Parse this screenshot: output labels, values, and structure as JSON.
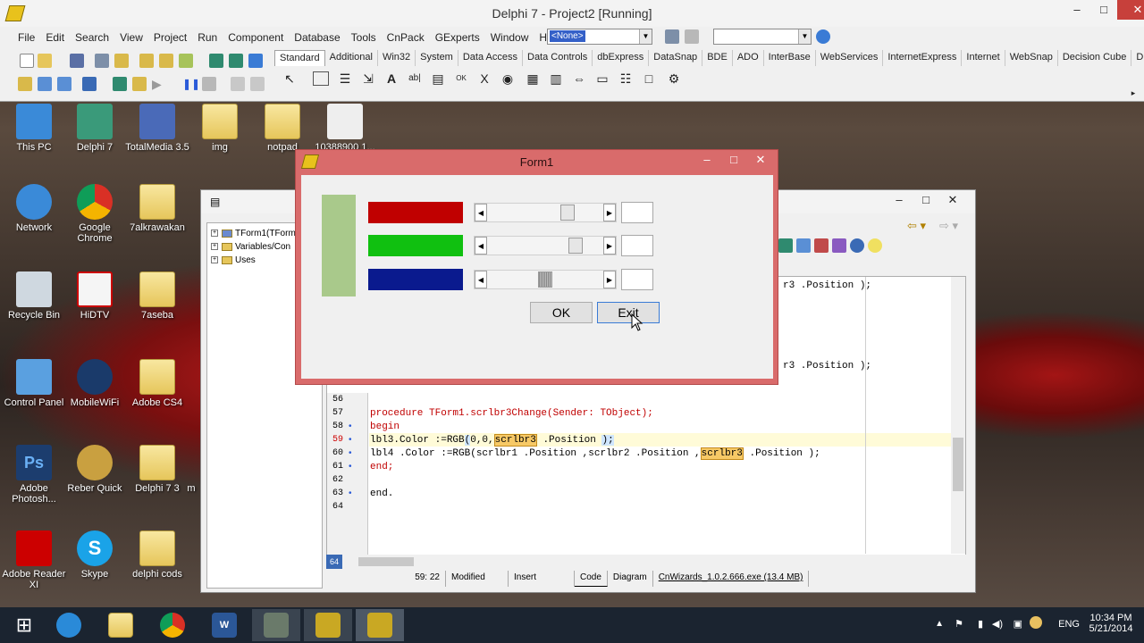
{
  "ide": {
    "title": "Delphi 7 - Project2 [Running]",
    "menu": [
      "File",
      "Edit",
      "Search",
      "View",
      "Project",
      "Run",
      "Component",
      "Database",
      "Tools",
      "CnPack",
      "GExperts",
      "Window",
      "Help"
    ],
    "desktop_combo": "<None>",
    "palette_tabs": [
      "Standard",
      "Additional",
      "Win32",
      "System",
      "Data Access",
      "Data Controls",
      "dbExpress",
      "DataSnap",
      "BDE",
      "ADO",
      "InterBase",
      "WebServices",
      "InternetExpress",
      "Internet",
      "WebSnap",
      "Decision Cube",
      "Dialo"
    ],
    "palette_labels": [
      "A",
      "ab|",
      "OK",
      "X"
    ]
  },
  "desktop": {
    "icons": [
      {
        "label": "This PC"
      },
      {
        "label": "Delphi 7"
      },
      {
        "label": "TotalMedia 3.5"
      },
      {
        "label": "img"
      },
      {
        "label": "notpad"
      },
      {
        "label": "10388900 1..."
      },
      {
        "label": "Network"
      },
      {
        "label": "Google Chrome"
      },
      {
        "label": "7alkrawakan"
      },
      {
        "label": "Recycle Bin"
      },
      {
        "label": "HiDTV"
      },
      {
        "label": "7aseba"
      },
      {
        "label": "Control Panel"
      },
      {
        "label": "MobileWiFi"
      },
      {
        "label": "Adobe CS4"
      },
      {
        "label": "Adobe Photosh..."
      },
      {
        "label": "Reber Quick"
      },
      {
        "label": "Delphi 7 3"
      },
      {
        "label": "m"
      },
      {
        "label": "Adobe Reader XI"
      },
      {
        "label": "Skype"
      },
      {
        "label": "delphi cods"
      }
    ]
  },
  "editor": {
    "tree": [
      "TForm1(TForm",
      "Variables/Con",
      "Uses"
    ],
    "top_lines": [
      {
        "text": "r3 .Position );"
      },
      {
        "text": "r3 .Position );"
      }
    ],
    "lines": [
      {
        "num": "56",
        "dot": "",
        "text": ""
      },
      {
        "num": "57",
        "dot": "",
        "text": "procedure TForm1.scrlbr3Change(Sender: TObject);"
      },
      {
        "num": "58",
        "dot": "•",
        "text": "begin"
      },
      {
        "num": "59",
        "dot": "•",
        "text": "lbl3.Color :=RGB(0,0,scrlbr3 .Position );"
      },
      {
        "num": "60",
        "dot": "•",
        "text": "lbl4 .Color :=RGB(scrlbr1 .Position ,scrlbr2 .Position ,scrlbr3 .Position );"
      },
      {
        "num": "61",
        "dot": "•",
        "text": "end;"
      },
      {
        "num": "62",
        "dot": "",
        "text": ""
      },
      {
        "num": "63",
        "dot": "•",
        "text": "end."
      },
      {
        "num": "64",
        "dot": "",
        "text": ""
      }
    ],
    "line59": {
      "a": "lbl3.Color :=RGB",
      "b": "(",
      "c": "0,0,",
      "d": "scrlbr3",
      "e": " .Position ",
      "f": ");"
    },
    "line60": {
      "a": "lbl4 .Color :=RGB(scrlbr1 .Position ,scrlbr2 .Position ,",
      "b": "scrlbr3",
      "c": " .Position );"
    },
    "gutter_bottom": "64",
    "status": {
      "pos": "59: 22",
      "modified": "Modified",
      "mode": "Insert",
      "tab_code": "Code",
      "tab_diagram": "Diagram",
      "cnwizards": "CnWizards_1.0.2.666.exe (13.4 MB)"
    }
  },
  "form1": {
    "title": "Form1",
    "ok": "OK",
    "exit": "Exit",
    "colors": {
      "preview": "#a9c98b",
      "red": "#c00000",
      "green": "#10c010",
      "blue": "#0a1a8e"
    },
    "scroll_positions": [
      0.72,
      0.8,
      0.5
    ]
  },
  "taskbar": {
    "lang": "ENG",
    "time": "10:34 PM",
    "date": "5/21/2014"
  }
}
